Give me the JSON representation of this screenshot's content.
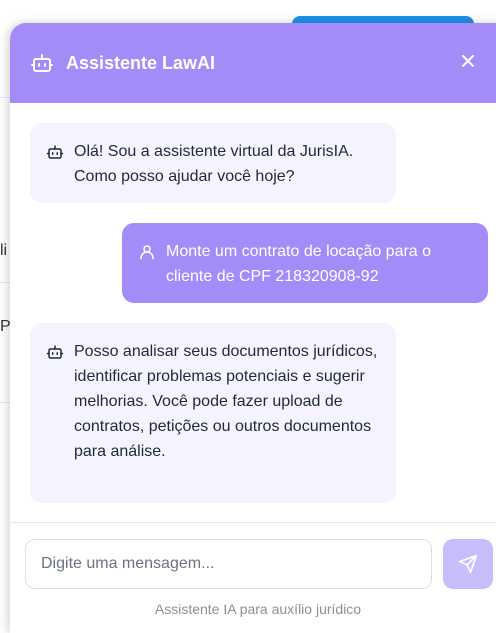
{
  "header": {
    "title": "Assistente LawAI",
    "icon": "bot-icon",
    "close_icon": "close-icon"
  },
  "messages": [
    {
      "role": "assistant",
      "icon": "bot-icon",
      "text": "Olá! Sou a assistente virtual da JurisIA. Como posso ajudar você hoje?"
    },
    {
      "role": "user",
      "icon": "user-icon",
      "text": "Monte um contrato de locação para o cliente de CPF 218320908-92"
    },
    {
      "role": "assistant",
      "icon": "bot-icon",
      "text": "Posso analisar seus documentos jurídicos, identificar problemas potenciais e sugerir melhorias. Você pode fazer upload de contratos, petições ou outros documentos para análise."
    }
  ],
  "input": {
    "placeholder": "Digite uma mensagem...",
    "value": ""
  },
  "send_icon": "send-icon",
  "footer": "Assistente IA para auxílio jurídico",
  "background": {
    "fragment_1": "li",
    "fragment_2": "P"
  },
  "colors": {
    "accent": "#a38cf7",
    "assistant_bubble": "#f5f3ff",
    "send_button": "#c9bdfb"
  }
}
